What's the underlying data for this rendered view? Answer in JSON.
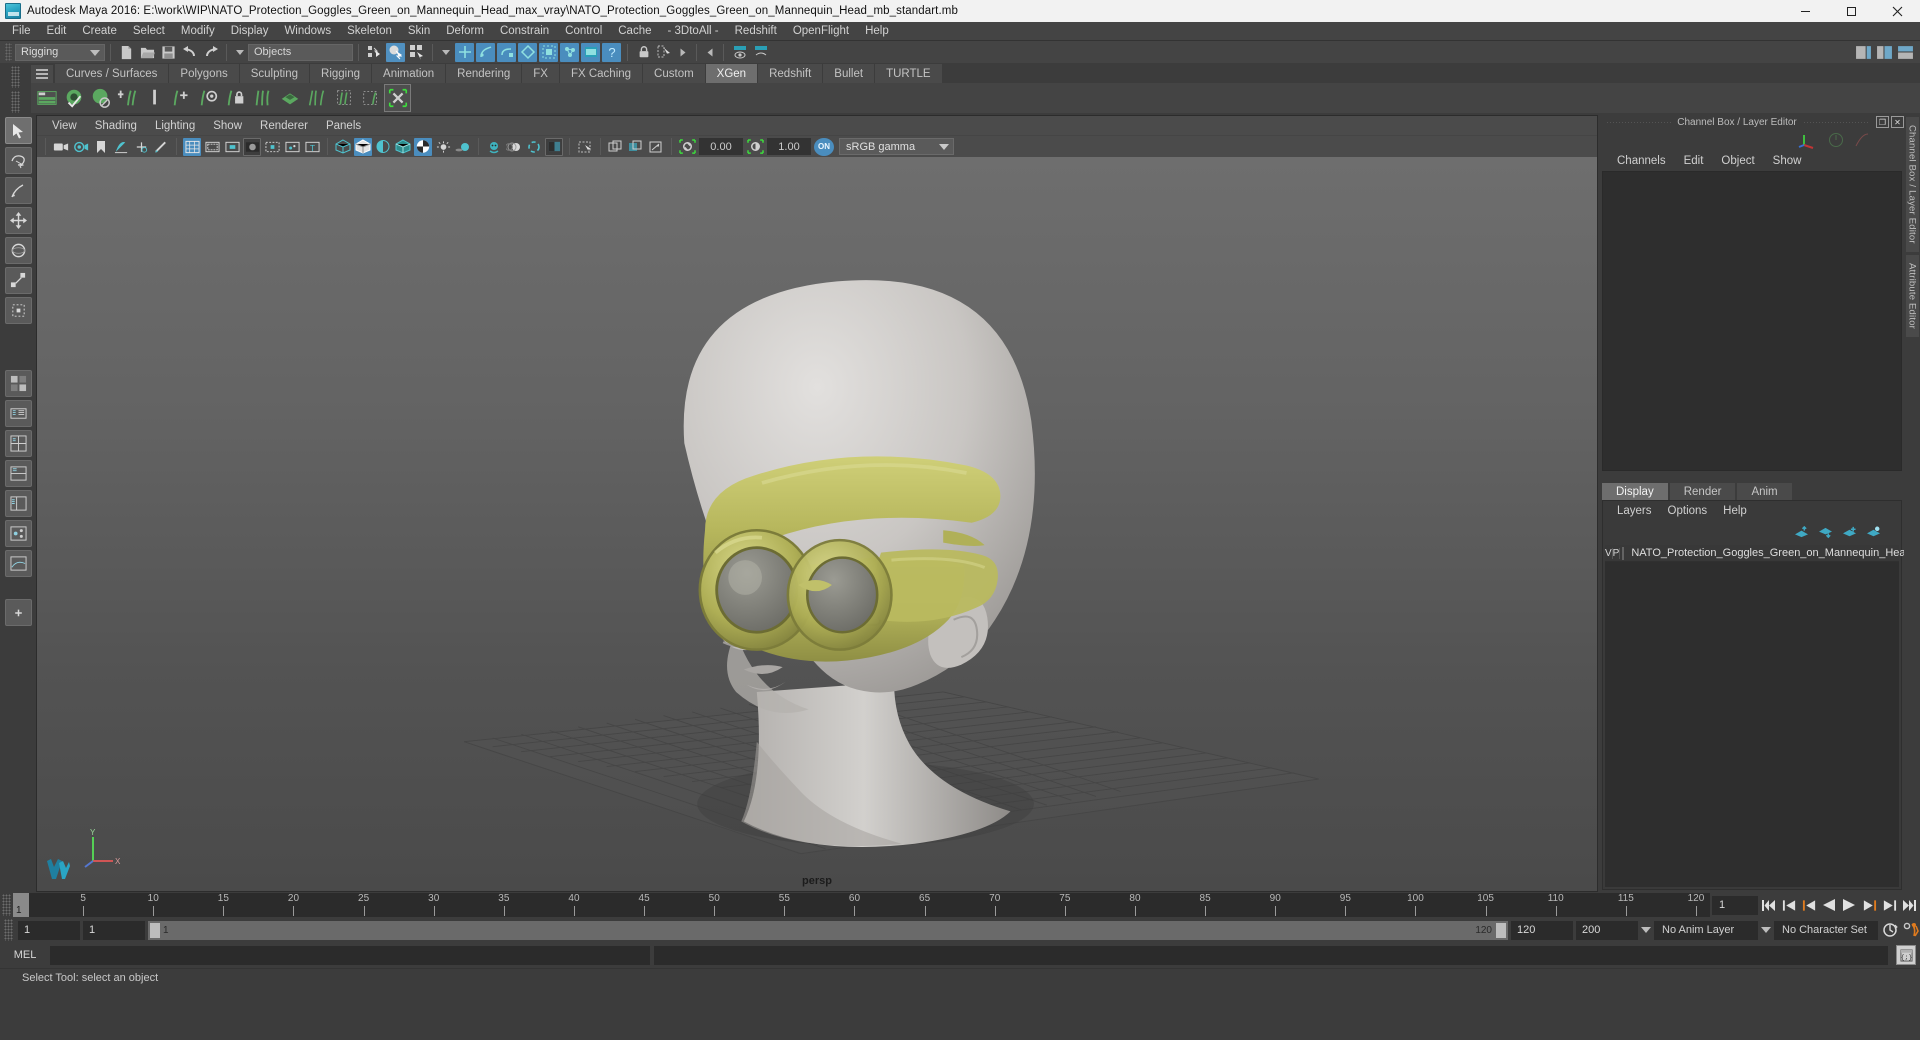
{
  "window": {
    "title": "Autodesk Maya 2016: E:\\work\\WIP\\NATO_Protection_Goggles_Green_on_Mannequin_Head_max_vray\\NATO_Protection_Goggles_Green_on_Mannequin_Head_mb_standart.mb",
    "app_icon": "maya-icon",
    "minimize": "–",
    "maximize": "❐",
    "close": "✕"
  },
  "menubar": {
    "items": [
      "File",
      "Edit",
      "Create",
      "Select",
      "Modify",
      "Display",
      "Windows",
      "Skeleton",
      "Skin",
      "Deform",
      "Constrain",
      "Control",
      "Cache",
      "- 3DtoAll -",
      "Redshift",
      "OpenFlight",
      "Help"
    ]
  },
  "statusbar": {
    "menu_set": "Rigging",
    "selection_mask": "Objects",
    "icons": [
      "new-scene-icon",
      "open-scene-icon",
      "save-scene-icon",
      "undo-icon",
      "redo-icon",
      "select-hierarchy-icon",
      "select-object-icon",
      "select-component-icon",
      "snap-grid-icon",
      "snap-curve-icon",
      "snap-point-icon",
      "snap-projected-icon",
      "snap-view-plane-icon",
      "make-live-icon",
      "snap-keyframe-icon",
      "history-icon",
      "lock-icon",
      "render-icon",
      "show-hide-icon"
    ]
  },
  "shelf": {
    "tabs": [
      "Curves / Surfaces",
      "Polygons",
      "Sculpting",
      "Rigging",
      "Animation",
      "Rendering",
      "FX",
      "FX Caching",
      "Custom",
      "XGen",
      "Redshift",
      "Bullet",
      "TURTLE"
    ],
    "active_tab": "XGen",
    "icons": [
      "xgen-editor-icon",
      "xgen-preview-icon",
      "xgen-sphere-icon",
      "xgen-add-guide-icon",
      "xgen-guide-icon",
      "xgen-add-point-icon",
      "xgen-preview-refresh-icon",
      "xgen-lock-icon",
      "xgen-comb-icon",
      "xgen-density-icon",
      "xgen-clump-icon",
      "xgen-noise-icon",
      "xgen-region-icon",
      "xgen-export-icon"
    ]
  },
  "toolbox": {
    "items": [
      "select-tool",
      "lasso-select-tool",
      "paint-select-tool",
      "move-tool",
      "rotate-tool",
      "scale-tool",
      "universal-manipulator-tool",
      "soft-select-tool",
      "last-tool-used",
      "layout-single-icon",
      "layout-four-view-icon",
      "layout-two-pane-icon",
      "layout-persp-outliner-icon",
      "layout-hypergraph-icon",
      "layout-persp-graph-icon",
      "layout-more-icon"
    ]
  },
  "viewport": {
    "menus": [
      "View",
      "Shading",
      "Lighting",
      "Show",
      "Renderer",
      "Panels"
    ],
    "toolbar_icons": [
      "select-camera-icon",
      "camera-attributes-icon",
      "bookmark-icon",
      "image-plane-icon",
      "two-d-pan-zoom-icon",
      "grease-pencil-icon",
      "grid-icon",
      "film-gate-icon",
      "resolution-gate-icon",
      "gate-mask-icon",
      "field-chart-icon",
      "safe-action-icon",
      "title-safe-icon",
      "wireframe-icon",
      "smooth-shade-icon",
      "shaded-wireframe-icon",
      "use-default-material-icon",
      "textured-icon",
      "use-all-lights-icon",
      "shadows-icon",
      "screen-space-ao-icon",
      "motion-blur-icon",
      "multisample-icon",
      "isolate-select-icon",
      "xray-icon",
      "xray-joints-icon",
      "xray-active-components-icon"
    ],
    "exposure_value": "0.00",
    "gamma_value": "1.00",
    "view_transform": "sRGB gamma",
    "camera_label": "persp",
    "gate_toggle": "ON"
  },
  "right_dock": {
    "panel_title": "Channel Box / Layer Editor",
    "undock_btn": "❐",
    "close_btn": "✕",
    "channelbox": {
      "menus": [
        "Channels",
        "Edit",
        "Object",
        "Show"
      ]
    },
    "layer_editor": {
      "tabs": [
        "Display",
        "Render",
        "Anim"
      ],
      "active_tab": "Display",
      "menus": [
        "Layers",
        "Options",
        "Help"
      ],
      "buttons": [
        "move-layer-up-icon",
        "move-layer-down-icon",
        "new-layer-icon",
        "new-layer-from-selected-icon"
      ],
      "layers": [
        {
          "visibility": "V",
          "playback": "P",
          "color": "#c61f3e",
          "name": "NATO_Protection_Goggles_Green_on_Mannequin_Head"
        }
      ]
    },
    "vertical_tabs": [
      "Channel Box / Layer Editor",
      "Attribute Editor"
    ]
  },
  "timeline": {
    "current_frame_marker": "1",
    "labels": [
      "5",
      "10",
      "15",
      "20",
      "25",
      "30",
      "35",
      "40",
      "45",
      "50",
      "55",
      "60",
      "65",
      "70",
      "75",
      "80",
      "85",
      "90",
      "95",
      "100",
      "105",
      "110",
      "115",
      "120"
    ],
    "current_frame_field": "1",
    "playback_buttons": [
      "go-to-start-icon",
      "step-back-keyframe-icon",
      "step-back-frame-icon",
      "play-backwards-icon",
      "play-forwards-icon",
      "step-forward-frame-icon",
      "step-forward-keyframe-icon",
      "go-to-end-icon"
    ]
  },
  "range": {
    "anim_start": "1",
    "range_start": "1",
    "slider_min": "1",
    "slider_max": "120",
    "range_end": "120",
    "anim_end": "200",
    "anim_layer": "No Anim Layer",
    "character_set": "No Character Set",
    "buttons": [
      "auto-keyframe-icon",
      "animation-preferences-icon"
    ]
  },
  "mel": {
    "label": "MEL",
    "command_value": "",
    "output_value": "",
    "script_editor_btn": "script-editor-icon"
  },
  "status_line": {
    "text": "Select Tool: select an object"
  },
  "colors": {
    "accent_blue": "#4a8dbe",
    "xgen_green": "#5ba860",
    "layer_red": "#c61f3e",
    "orange": "#e07b1e",
    "panel_bg": "#3c3c3c",
    "viewport_top": "#6e6e6e"
  }
}
